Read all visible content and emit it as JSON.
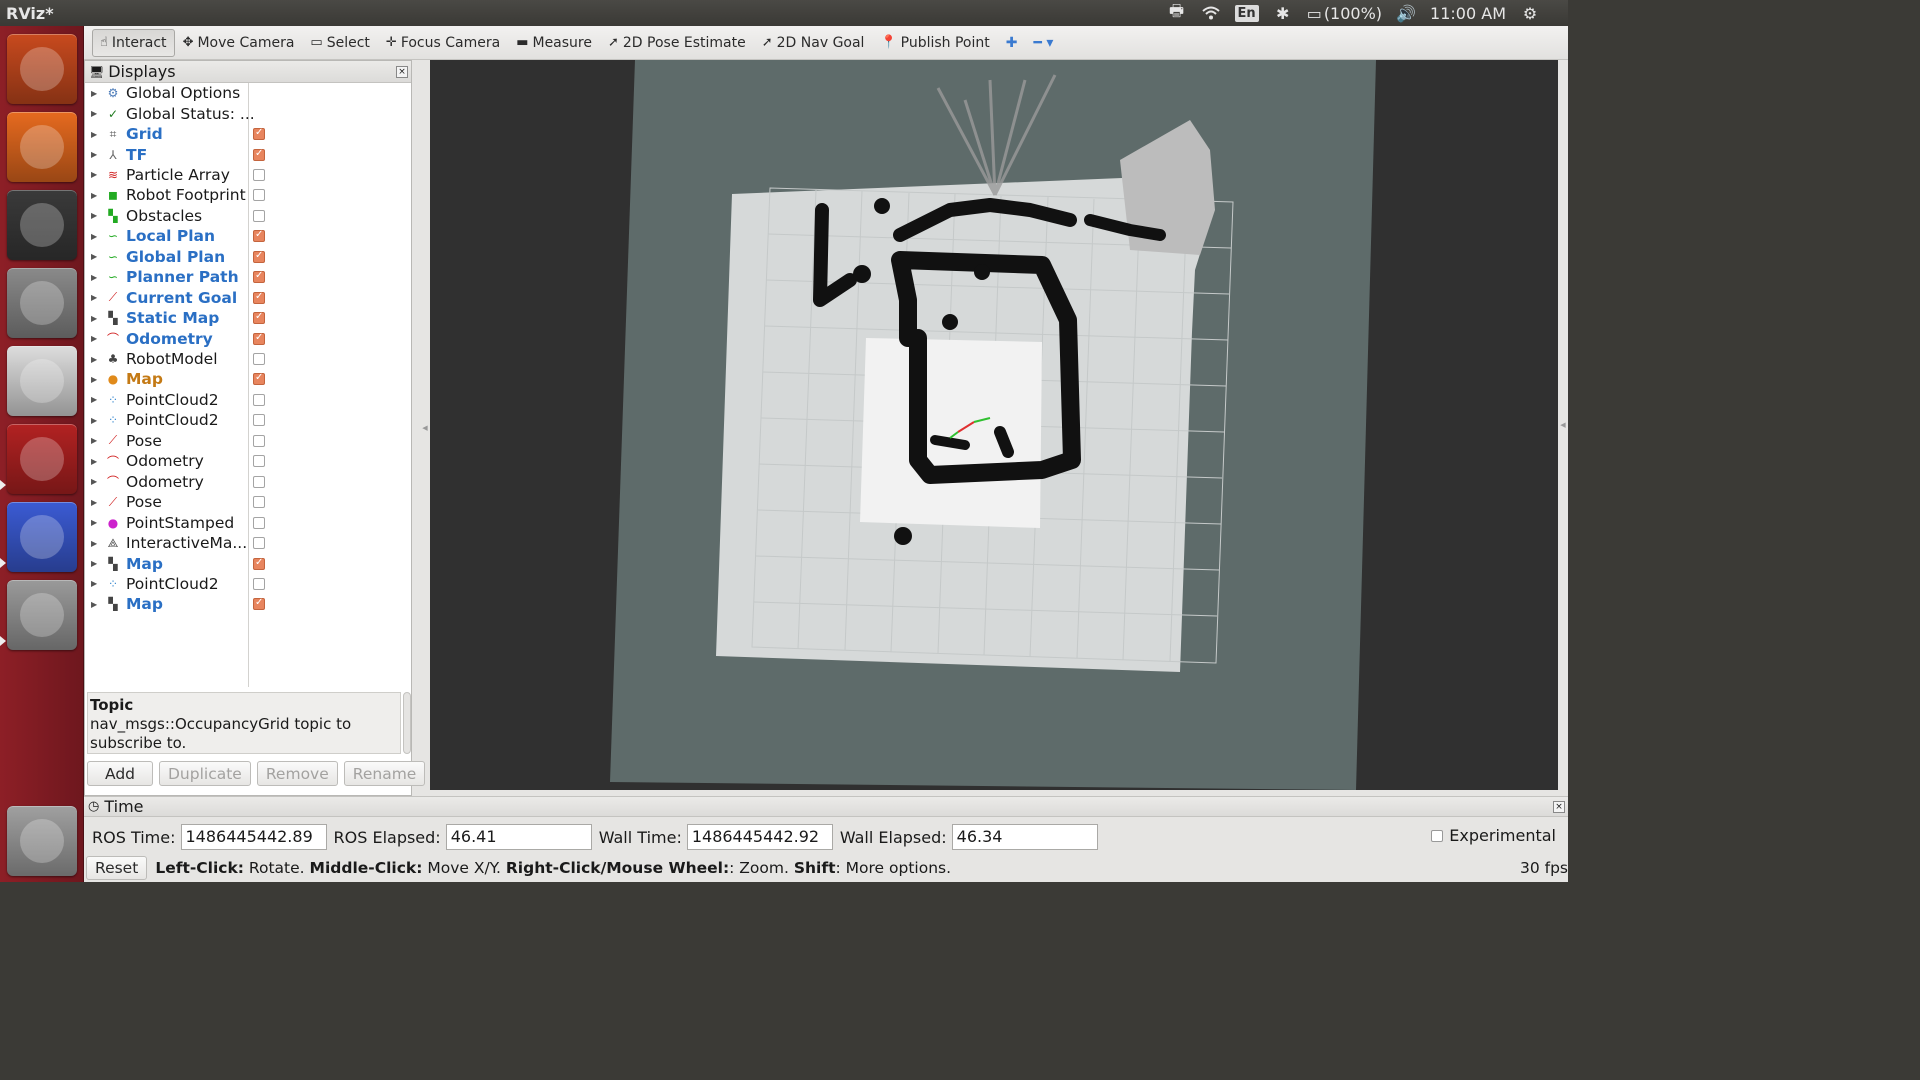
{
  "window": {
    "title": "RViz*",
    "clock": "11:00 AM",
    "battery": "(100%)",
    "language": "En"
  },
  "launcher": [
    {
      "name": "ubuntu-dash",
      "color": "#c84a1e"
    },
    {
      "name": "firefox",
      "color": "#e66a1f"
    },
    {
      "name": "terminal",
      "color": "#3a3a3a"
    },
    {
      "name": "files",
      "color": "#8a8a8a"
    },
    {
      "name": "text-editor",
      "color": "#dddddd"
    },
    {
      "name": "terminator",
      "color": "#b22222"
    },
    {
      "name": "r-language",
      "color": "#3b5bd4"
    },
    {
      "name": "rviz",
      "color": "#9a9a9a"
    },
    {
      "name": "trash",
      "color": "#a0a0a0"
    }
  ],
  "toolbar": {
    "tools": [
      {
        "label": "Interact",
        "icon": "hand-icon",
        "glyph": "☝",
        "active": true
      },
      {
        "label": "Move Camera",
        "icon": "move-camera-icon",
        "glyph": "✥"
      },
      {
        "label": "Select",
        "icon": "select-icon",
        "glyph": "▭"
      },
      {
        "label": "Focus Camera",
        "icon": "focus-camera-icon",
        "glyph": "✛"
      },
      {
        "label": "Measure",
        "icon": "measure-icon",
        "glyph": "▬"
      },
      {
        "label": "2D Pose Estimate",
        "icon": "pose-estimate-icon",
        "glyph": "➚"
      },
      {
        "label": "2D Nav Goal",
        "icon": "nav-goal-icon",
        "glyph": "➚"
      },
      {
        "label": "Publish Point",
        "icon": "publish-point-icon",
        "glyph": "📍"
      }
    ],
    "add_tool": "✚",
    "remove_tool": "━ ▾"
  },
  "displays": {
    "title": "Displays",
    "items": [
      {
        "label": "Global Options",
        "icon": "gear-icon",
        "glyph": "⚙",
        "iconColor": "#4a7ab8",
        "state": "none",
        "style": "normal"
      },
      {
        "label": "Global Status: ...",
        "icon": "check-icon",
        "glyph": "✓",
        "iconColor": "#1f7a1f",
        "state": "none",
        "style": "normal"
      },
      {
        "label": "Grid",
        "icon": "grid-icon",
        "glyph": "⌗",
        "iconColor": "#555555",
        "state": "on",
        "style": "on"
      },
      {
        "label": "TF",
        "icon": "tf-icon",
        "glyph": "⅄",
        "iconColor": "#666666",
        "state": "on",
        "style": "on"
      },
      {
        "label": "Particle Array",
        "icon": "particle-array-icon",
        "glyph": "≋",
        "iconColor": "#d02020",
        "state": "off",
        "style": "normal"
      },
      {
        "label": "Robot Footprint",
        "icon": "polygon-icon",
        "glyph": "◼",
        "iconColor": "#22aa22",
        "state": "off",
        "style": "normal"
      },
      {
        "label": "Obstacles",
        "icon": "grid-cells-icon",
        "glyph": "▚",
        "iconColor": "#22aa22",
        "state": "off",
        "style": "normal"
      },
      {
        "label": "Local Plan",
        "icon": "path-icon",
        "glyph": "∽",
        "iconColor": "#22aa22",
        "state": "on",
        "style": "on"
      },
      {
        "label": "Global Plan",
        "icon": "path-icon",
        "glyph": "∽",
        "iconColor": "#22aa22",
        "state": "on",
        "style": "on"
      },
      {
        "label": "Planner Path",
        "icon": "path-icon",
        "glyph": "∽",
        "iconColor": "#22aa22",
        "state": "on",
        "style": "on"
      },
      {
        "label": "Current Goal",
        "icon": "pose-icon",
        "glyph": "⟋",
        "iconColor": "#d02020",
        "state": "on",
        "style": "on"
      },
      {
        "label": "Static Map",
        "icon": "map-icon",
        "glyph": "▚",
        "iconColor": "#444444",
        "state": "on",
        "style": "on"
      },
      {
        "label": "Odometry",
        "icon": "odometry-icon",
        "glyph": "⌒",
        "iconColor": "#d02020",
        "state": "on",
        "style": "on"
      },
      {
        "label": "RobotModel",
        "icon": "robot-model-icon",
        "glyph": "♣",
        "iconColor": "#444444",
        "state": "off",
        "style": "normal"
      },
      {
        "label": "Map",
        "icon": "warning-icon",
        "glyph": "●",
        "iconColor": "#e08a1a",
        "state": "on",
        "style": "warn"
      },
      {
        "label": "PointCloud2",
        "icon": "pointcloud-icon",
        "glyph": "⁘",
        "iconColor": "#3a8ad0",
        "state": "off",
        "style": "normal"
      },
      {
        "label": "PointCloud2",
        "icon": "pointcloud-icon",
        "glyph": "⁘",
        "iconColor": "#3a8ad0",
        "state": "off",
        "style": "normal"
      },
      {
        "label": "Pose",
        "icon": "pose-icon",
        "glyph": "⟋",
        "iconColor": "#d02020",
        "state": "off",
        "style": "normal"
      },
      {
        "label": "Odometry",
        "icon": "odometry-icon",
        "glyph": "⌒",
        "iconColor": "#d02020",
        "state": "off",
        "style": "normal"
      },
      {
        "label": "Odometry",
        "icon": "odometry-icon",
        "glyph": "⌒",
        "iconColor": "#d02020",
        "state": "off",
        "style": "normal"
      },
      {
        "label": "Pose",
        "icon": "pose-icon",
        "glyph": "⟋",
        "iconColor": "#d02020",
        "state": "off",
        "style": "normal"
      },
      {
        "label": "PointStamped",
        "icon": "point-icon",
        "glyph": "●",
        "iconColor": "#cc22cc",
        "state": "off",
        "style": "normal"
      },
      {
        "label": "InteractiveMa...",
        "icon": "interactive-marker-icon",
        "glyph": "⟁",
        "iconColor": "#444444",
        "state": "off",
        "style": "normal"
      },
      {
        "label": "Map",
        "icon": "map-icon",
        "glyph": "▚",
        "iconColor": "#444444",
        "state": "on",
        "style": "on"
      },
      {
        "label": "PointCloud2",
        "icon": "pointcloud-icon",
        "glyph": "⁘",
        "iconColor": "#3a8ad0",
        "state": "off",
        "style": "normal"
      },
      {
        "label": "Map",
        "icon": "map-icon",
        "glyph": "▚",
        "iconColor": "#444444",
        "state": "on",
        "style": "on"
      }
    ],
    "description_title": "Topic",
    "description_text": "nav_msgs::OccupancyGrid topic to subscribe to.",
    "buttons": {
      "add": "Add",
      "duplicate": "Duplicate",
      "remove": "Remove",
      "rename": "Rename"
    }
  },
  "time": {
    "title": "Time",
    "ros_time_label": "ROS Time:",
    "ros_time": "1486445442.89",
    "ros_elapsed_label": "ROS Elapsed:",
    "ros_elapsed": "46.41",
    "wall_time_label": "Wall Time:",
    "wall_time": "1486445442.92",
    "wall_elapsed_label": "Wall Elapsed:",
    "wall_elapsed": "46.34",
    "experimental_label": "Experimental"
  },
  "status": {
    "reset": "Reset",
    "hint_parts": [
      {
        "b": "Left-Click:",
        "t": " Rotate. "
      },
      {
        "b": "Middle-Click:",
        "t": " Move X/Y. "
      },
      {
        "b": "Right-Click/Mouse Wheel:",
        "t": ": Zoom. "
      },
      {
        "b": "Shift",
        "t": ": More options."
      }
    ],
    "fps": "30 fps"
  },
  "colors": {
    "background_plane": "#5e6b6a",
    "map_free": "#d9dcdc",
    "map_unknown_dark": "#303030",
    "obstacle": "#111111"
  }
}
